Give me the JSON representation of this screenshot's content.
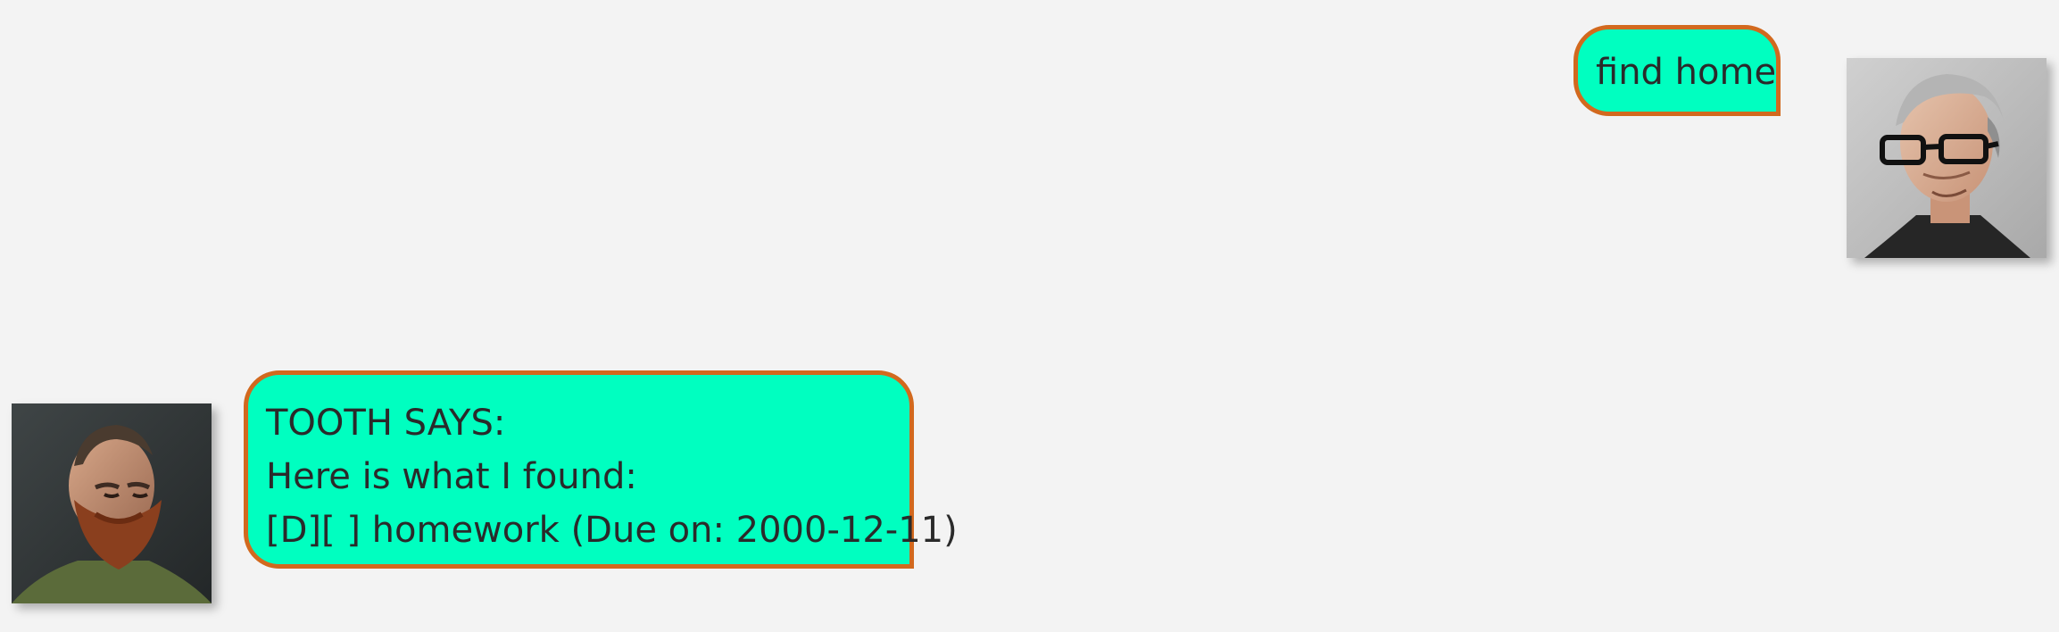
{
  "conversation": {
    "user_message": "find home",
    "bot_message": {
      "line1": "TOOTH SAYS:",
      "line2": "Here is what I found:",
      "line3": "[D][ ] homework (Due on: 2000-12-11)"
    }
  },
  "colors": {
    "page_background": "#f3f3f3",
    "bubble_fill": "#00ffc0",
    "bubble_border": "#d2691e",
    "text": "#2a2a2a"
  },
  "icons": {
    "user_avatar": "user-avatar-icon",
    "bot_avatar": "bot-avatar-icon"
  }
}
